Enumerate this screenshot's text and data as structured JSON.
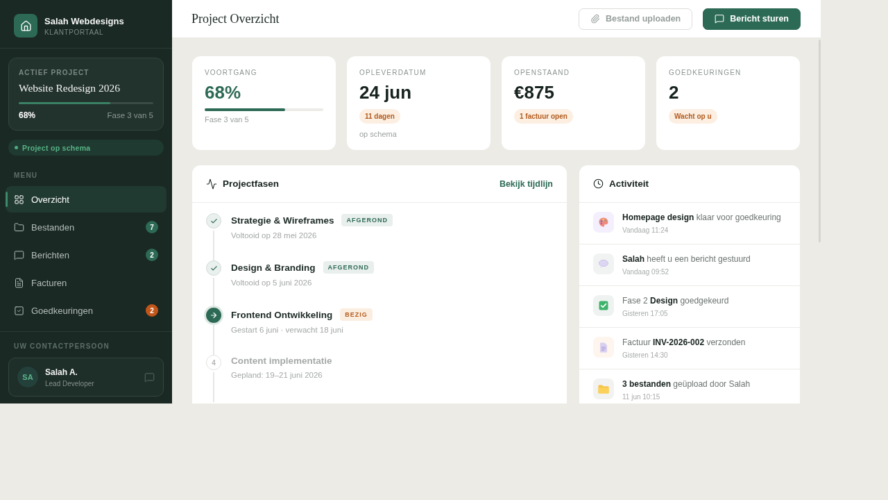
{
  "sidebar": {
    "brand": {
      "name": "Salah Webdesigns",
      "subtitle": "KLANTPORTAAL"
    },
    "active_project": {
      "label": "ACTIEF PROJECT",
      "name": "Website Redesign 2026",
      "level": 0.68,
      "percent": "68%",
      "phase": "Fase 3 van 5"
    },
    "status": {
      "label": "Project op schema"
    },
    "menu_label": "MENU",
    "menu": [
      {
        "kind": "overview",
        "label": "Overzicht",
        "selected": true
      },
      {
        "kind": "files",
        "label": "Bestanden",
        "selected": false,
        "badge": {
          "count": "7",
          "color": "#2d6a55"
        }
      },
      {
        "kind": "messages",
        "label": "Berichten",
        "selected": false,
        "badge": {
          "count": "2",
          "color": "#2d6a55"
        }
      },
      {
        "kind": "invoices",
        "label": "Facturen",
        "selected": false
      },
      {
        "kind": "approvals",
        "label": "Goedkeuringen",
        "selected": false,
        "badge": {
          "count": "2",
          "color": "#c2561a"
        }
      }
    ],
    "contact_label": "UW CONTACTPERSOON",
    "contact": {
      "initials": "SA",
      "name": "Salah A.",
      "role": "Lead Developer"
    }
  },
  "header": {
    "title": "Project Overzicht",
    "buttons": [
      {
        "kind": "secondary",
        "label": "Bestand uploaden"
      },
      {
        "kind": "primary",
        "label": "Bericht sturen"
      }
    ]
  },
  "stats": [
    {
      "kind": "progress",
      "label": "VOORTGANG",
      "value": "68%",
      "level": 0.68,
      "note": "Fase 3 van 5"
    },
    {
      "kind": "pill",
      "label": "OPLEVERDATUM",
      "value": "24 jun",
      "pill": "11 dagen",
      "note": "op schema"
    },
    {
      "kind": "pill",
      "label": "OPENSTAAND",
      "value": "€875",
      "pill": "1 factuur open"
    },
    {
      "kind": "pill",
      "label": "GOEDKEURINGEN",
      "value": "2",
      "pill": "Wacht op u"
    }
  ],
  "phases": {
    "title": "Projectfasen",
    "link": "Bekijk tijdlijn",
    "items": [
      {
        "kind": "done",
        "title": "Strategie & Wireframes",
        "tag": "AFGEROND",
        "detail": "Voltooid op 28 mei 2026"
      },
      {
        "kind": "done",
        "title": "Design & Branding",
        "tag": "AFGEROND",
        "detail": "Voltooid op 5 juni 2026"
      },
      {
        "kind": "current",
        "title": "Frontend Ontwikkeling",
        "tag": "BEZIG",
        "detail": "Gestart 6 juni · verwacht 18 juni"
      },
      {
        "kind": "planned",
        "step": "4",
        "title": "Content implementatie",
        "detail": "Gepland: 19–21 juni 2026"
      }
    ]
  },
  "activity": {
    "title": "Activiteit",
    "items": [
      {
        "kind": "design",
        "text": "**Homepage design** klaar voor goedkeuring",
        "time": "Vandaag 11:24"
      },
      {
        "kind": "message",
        "text": "**Salah** heeft u een bericht gestuurd",
        "time": "Vandaag 09:52"
      },
      {
        "kind": "approval",
        "text": "Fase 2 **Design** goedgekeurd",
        "time": "Gisteren 17:05"
      },
      {
        "kind": "invoice",
        "text": "Factuur **INV-2026-002** verzonden",
        "time": "Gisteren 14:30"
      },
      {
        "kind": "files",
        "text": "**3 bestanden** geüpload door Salah",
        "time": "11 jun 10:15"
      }
    ]
  }
}
